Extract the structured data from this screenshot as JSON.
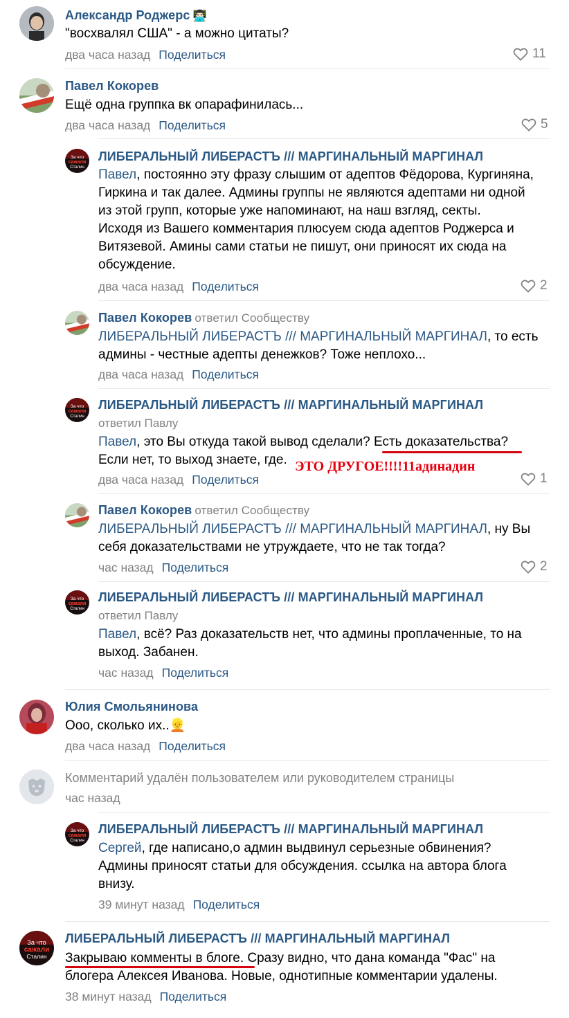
{
  "comments": [
    {
      "author": "Александр Роджерс",
      "author_emoji": "👨🏻‍💻",
      "text": "\"восхвалял США\" - а можно цитаты?",
      "time": "два часа назад",
      "share": "Поделиться",
      "likes": "11"
    },
    {
      "author": "Павел Кокорев",
      "text": "Ещё одна группка вк опарафинилась...",
      "time": "два часа назад",
      "share": "Поделиться",
      "likes": "5"
    },
    {
      "author": "ЛИБЕРАЛЬНЫЙ ЛИБЕРАСТЪ /// МАРГИНАЛЬНЫЙ МАРГИНАЛ",
      "mention": "Павел",
      "lines": [
        ", постоянно эту фразу слышим от адептов Фёдорова, Кургиняна,",
        "Гиркина и так далее. Админы группы не являются адептами ни одной",
        "из этой групп, которые уже напоминают, на наш взгляд, секты.",
        "Исходя из Вашего комментария плюсуем сюда адептов Роджерса и",
        "Витязевой. Амины сами статьи не пишут, они приносят их сюда на",
        "обсуждение."
      ],
      "time": "два часа назад",
      "share": "Поделиться",
      "likes": "2"
    },
    {
      "author": "Павел Кокорев",
      "reply_tag": "ответил Сообществу",
      "mention": "ЛИБЕРАЛЬНЫЙ ЛИБЕРАСТЪ /// МАРГИНАЛЬНЫЙ МАРГИНАЛ",
      "line1_rest": ", то есть",
      "line2": "админы - честные адепты денежков? Тоже неплохо...",
      "time": "два часа назад",
      "share": "Поделиться"
    },
    {
      "author": "ЛИБЕРАЛЬНЫЙ ЛИБЕРАСТЪ /// МАРГИНАЛЬНЫЙ МАРГИНАЛ",
      "reply_tag": "ответил Павлу",
      "mention": "Павел",
      "line1_rest": ", это Вы откуда такой вывод сделали? Есть доказательства?",
      "line2": "Если нет, то выход знаете, где.",
      "time": "два часа назад",
      "share": "Поделиться",
      "likes": "1",
      "annotation": "ЭТО ДРУГОЕ!!!!11адинадин"
    },
    {
      "author": "Павел Кокорев",
      "reply_tag": "ответил Сообществу",
      "mention": "ЛИБЕРАЛЬНЫЙ ЛИБЕРАСТЪ /// МАРГИНАЛЬНЫЙ МАРГИНАЛ",
      "line1_rest": ", ну Вы",
      "line2": "себя доказательствами не утруждаете, что не так тогда?",
      "time": "час назад",
      "share": "Поделиться",
      "likes": "2"
    },
    {
      "author": "ЛИБЕРАЛЬНЫЙ ЛИБЕРАСТЪ /// МАРГИНАЛЬНЫЙ МАРГИНАЛ",
      "reply_tag": "ответил Павлу",
      "mention": "Павел",
      "line1_rest": ", всё? Раз доказательств нет, что админы проплаченные, то на",
      "line2": "выход. Забанен.",
      "time": "час назад",
      "share": "Поделиться"
    },
    {
      "author": "Юлия Смольянинова",
      "text": "Ооо, сколько их..",
      "text_emoji": "👱",
      "time": "два часа назад",
      "share": "Поделиться"
    },
    {
      "deleted_text": "Комментарий удалён пользователем или руководителем страницы",
      "time": "час назад"
    },
    {
      "author": "ЛИБЕРАЛЬНЫЙ ЛИБЕРАСТЪ /// МАРГИНАЛЬНЫЙ МАРГИНАЛ",
      "mention": "Сергей",
      "line1_rest": ", где написано,о админ выдвинул серьезные обвинения?",
      "line2": "Админы приносят статьи для обсуждения. ссылка на автора блога",
      "line3": "внизу.",
      "time": "39 минут назад",
      "share": "Поделиться"
    },
    {
      "author": "ЛИБЕРАЛЬНЫЙ ЛИБЕРАСТЪ /// МАРГИНАЛЬНЫЙ МАРГИНАЛ",
      "line1": "Закрываю комменты в блоге. Сразу видно, что дана команда \"Фас\" на",
      "line2": "блогера Алексея Иванова. Новые, однотипные комментарии удалены.",
      "time": "38 минут назад",
      "share": "Поделиться"
    }
  ],
  "avatar_labels": {
    "community_line1": "За что",
    "community_line2": "сажали",
    "community_line3": "Сталин"
  },
  "colors": {
    "link": "#2a5885",
    "meta": "#828282",
    "annotation_red": "#e4000f"
  },
  "icons": {
    "like": "heart-outline-icon",
    "deleted_avatar": "dog-head-icon"
  }
}
